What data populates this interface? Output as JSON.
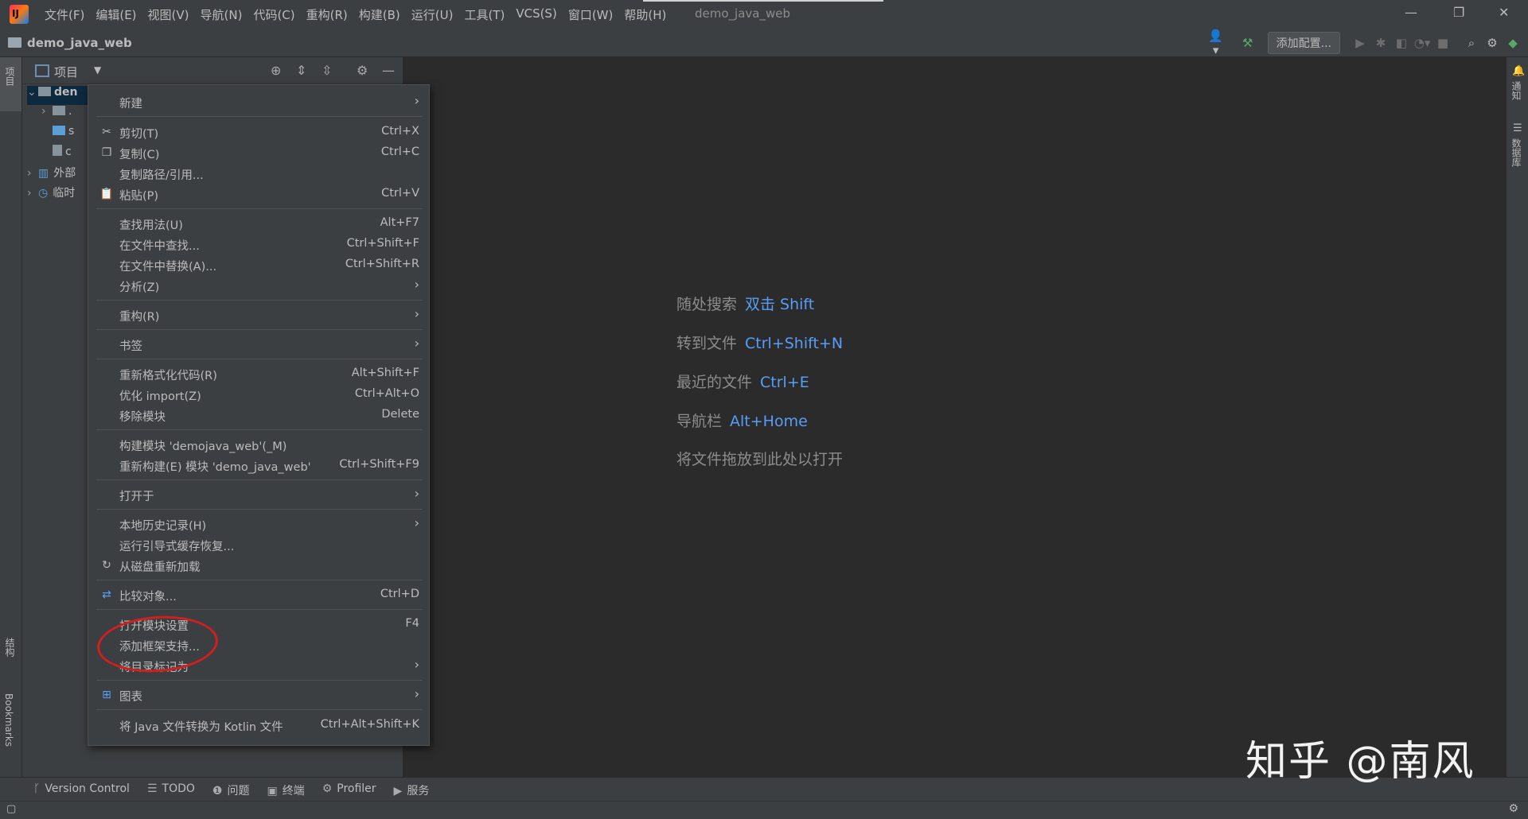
{
  "titlebar": {
    "menu": [
      "文件(F)",
      "编辑(E)",
      "视图(V)",
      "导航(N)",
      "代码(C)",
      "重构(R)",
      "构建(B)",
      "运行(U)",
      "工具(T)",
      "VCS(S)",
      "窗口(W)",
      "帮助(H)"
    ],
    "window_title": "demo_java_web"
  },
  "navbar": {
    "project_name": "demo_java_web",
    "add_config_label": "添加配置..."
  },
  "left_strip": {
    "project_tab": "项目",
    "structure_tab": "结构",
    "bookmarks_tab": "Bookmarks"
  },
  "right_strip": {
    "notifications_tab": "通知",
    "database_tab": "数据库"
  },
  "project_panel": {
    "title": "项目",
    "tree": [
      {
        "label": "den"
      },
      {
        "label": "."
      },
      {
        "label": "s"
      },
      {
        "label": "c"
      },
      {
        "label": "外部"
      },
      {
        "label": "临时"
      }
    ]
  },
  "context_menu": {
    "items": [
      {
        "label": "新建",
        "shortcut": "",
        "submenu": true
      },
      {
        "label": "剪切(T)",
        "shortcut": "Ctrl+X",
        "icon": "cut-icon"
      },
      {
        "label": "复制(C)",
        "shortcut": "Ctrl+C",
        "icon": "copy-icon"
      },
      {
        "label": "复制路径/引用...",
        "shortcut": ""
      },
      {
        "label": "粘贴(P)",
        "shortcut": "Ctrl+V",
        "icon": "paste-icon"
      },
      {
        "label": "查找用法(U)",
        "shortcut": "Alt+F7"
      },
      {
        "label": "在文件中查找...",
        "shortcut": "Ctrl+Shift+F"
      },
      {
        "label": "在文件中替换(A)...",
        "shortcut": "Ctrl+Shift+R"
      },
      {
        "label": "分析(Z)",
        "shortcut": "",
        "submenu": true
      },
      {
        "label": "重构(R)",
        "shortcut": "",
        "submenu": true
      },
      {
        "label": "书签",
        "shortcut": "",
        "submenu": true
      },
      {
        "label": "重新格式化代码(R)",
        "shortcut": "Alt+Shift+F"
      },
      {
        "label": "优化 import(Z)",
        "shortcut": "Ctrl+Alt+O"
      },
      {
        "label": "移除模块",
        "shortcut": "Delete"
      },
      {
        "label": "构建模块 'demojava_web'(_M)",
        "shortcut": ""
      },
      {
        "label": "重新构建(E) 模块 'demo_java_web'",
        "shortcut": "Ctrl+Shift+F9"
      },
      {
        "label": "打开于",
        "shortcut": "",
        "submenu": true
      },
      {
        "label": "本地历史记录(H)",
        "shortcut": "",
        "submenu": true
      },
      {
        "label": "运行引导式缓存恢复...",
        "shortcut": ""
      },
      {
        "label": "从磁盘重新加载",
        "shortcut": "",
        "icon": "reload-icon"
      },
      {
        "label": "比较对象...",
        "shortcut": "Ctrl+D",
        "icon": "compare-icon"
      },
      {
        "label": "打开模块设置",
        "shortcut": "F4"
      },
      {
        "label": "添加框架支持...",
        "shortcut": ""
      },
      {
        "label": "将目录标记为",
        "shortcut": "",
        "submenu": true
      },
      {
        "label": "图表",
        "shortcut": "",
        "submenu": true,
        "icon": "diagram-icon"
      },
      {
        "label": "将 Java 文件转换为 Kotlin 文件",
        "shortcut": "Ctrl+Alt+Shift+K"
      }
    ]
  },
  "editor_hints": [
    {
      "label": "随处搜索",
      "key": "双击 Shift"
    },
    {
      "label": "转到文件",
      "key": "Ctrl+Shift+N"
    },
    {
      "label": "最近的文件",
      "key": "Ctrl+E"
    },
    {
      "label": "导航栏",
      "key": "Alt+Home"
    },
    {
      "label": "将文件拖放到此处以打开",
      "key": ""
    }
  ],
  "bottom_tabs": [
    "Version Control",
    "TODO",
    "问题",
    "终端",
    "Profiler",
    "服务"
  ],
  "watermark": "知乎 @南风",
  "colors": {
    "accent_key": "#589df6",
    "annotation": "#d11e1e"
  }
}
